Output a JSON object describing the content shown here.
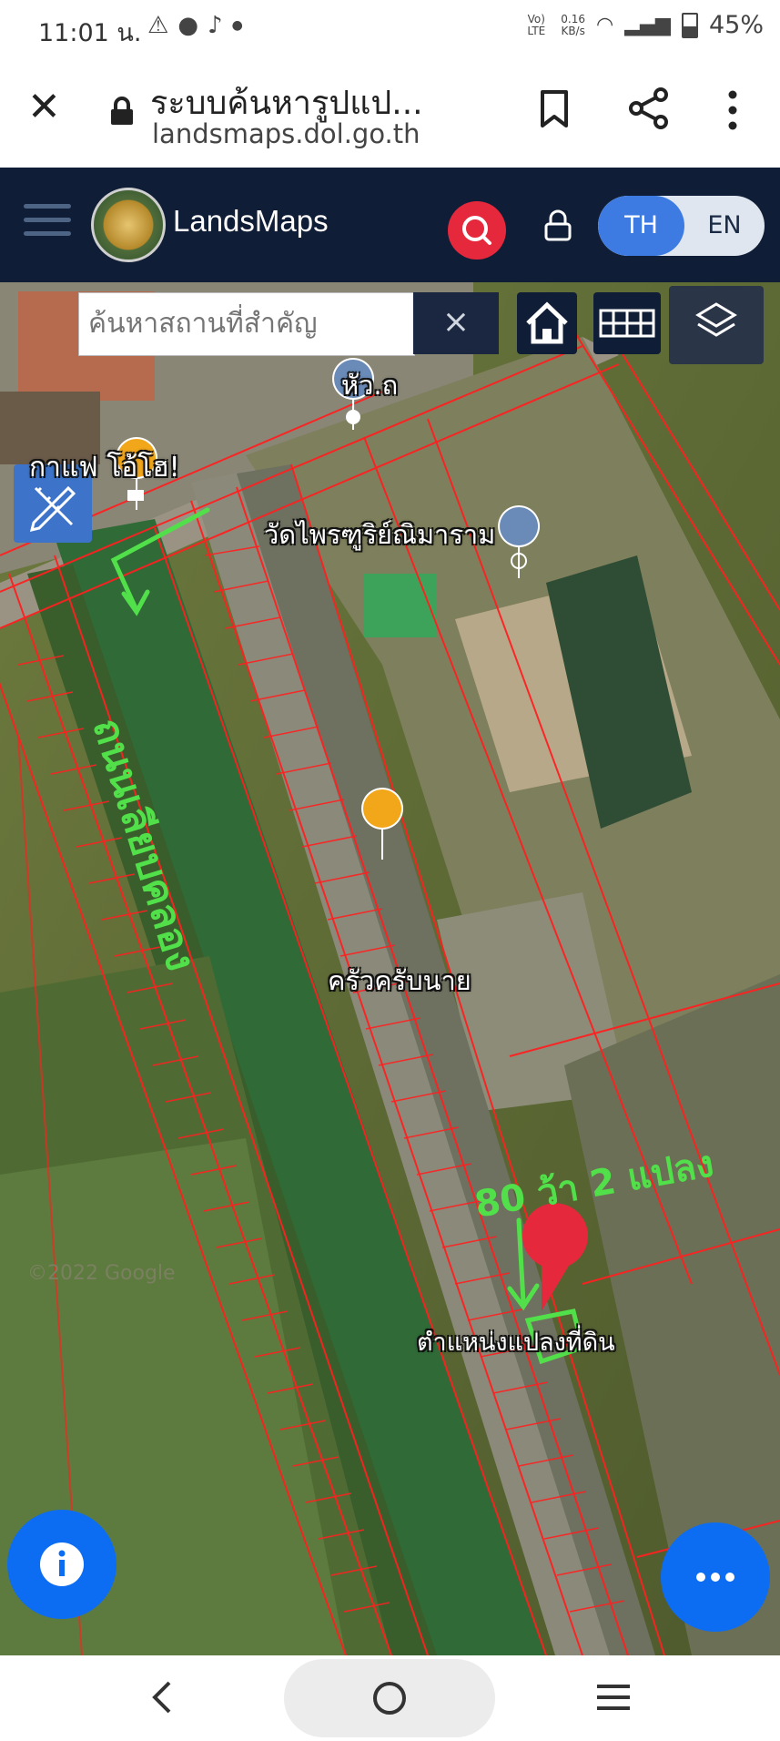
{
  "status_bar": {
    "time": "11:01 น.",
    "network_label": "Vo) LTE",
    "speed": "0.16",
    "speed_unit": "KB/s",
    "battery": "45%"
  },
  "browser": {
    "page_title": "ระบบค้นหารูปแป...",
    "url": "landsmaps.dol.go.th"
  },
  "app": {
    "brand": "LandsMaps",
    "lang_th": "TH",
    "lang_en": "EN"
  },
  "map": {
    "search_placeholder": "ค้นหาสถานที่สำคัญ",
    "clear_label": "×",
    "labels": {
      "road": "หัว.ถ",
      "cafe": "กาแฟ โอ้โฮ!",
      "temple": "วัดไพรฑูริย์ณิมาราม",
      "restaurant": "ครัวครับนาย",
      "parcel_position": "ตำแหน่งแปลงที่ดิน",
      "watermark": "©2022 Google"
    },
    "annotations": {
      "along_canal": "ถนนเลียบคลอง",
      "plot_size": "80 ว้า 2 แปลง"
    }
  },
  "icons": {
    "close": "close-icon",
    "lock": "lock-icon",
    "bookmark": "bookmark-icon",
    "share": "share-icon",
    "menu": "kebab-menu-icon",
    "hamburger": "hamburger-icon",
    "search": "search-icon",
    "home": "home-icon",
    "grid": "grid-icon",
    "layers": "layers-icon",
    "draw": "draw-tools-icon",
    "info": "info-icon",
    "more": "more-dots-icon"
  },
  "colors": {
    "app_header": "#0f1e36",
    "accent_blue": "#3d7be2",
    "search_red": "#e6283c",
    "parcel_lines": "#ff2020",
    "annotation_green": "#52e04a",
    "fab_blue": "#0d6df2"
  }
}
